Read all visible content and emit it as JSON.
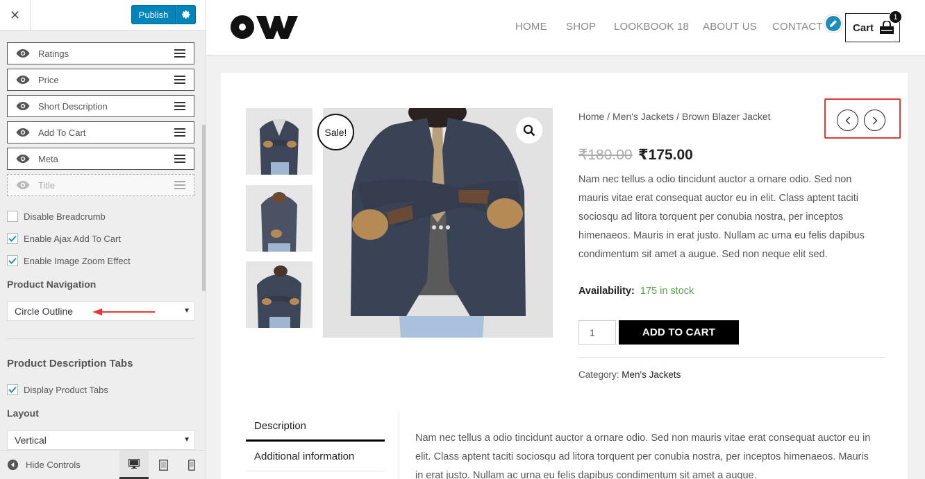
{
  "sidebar": {
    "publish_label": "Publish",
    "elements": [
      {
        "label": "Ratings",
        "visible": true
      },
      {
        "label": "Price",
        "visible": true
      },
      {
        "label": "Short Description",
        "visible": true
      },
      {
        "label": "Add To Cart",
        "visible": true
      },
      {
        "label": "Meta",
        "visible": true
      },
      {
        "label": "Title",
        "visible": false
      }
    ],
    "checkboxes": [
      {
        "label": "Disable Breadcrumb",
        "checked": false
      },
      {
        "label": "Enable Ajax Add To Cart",
        "checked": true
      },
      {
        "label": "Enable Image Zoom Effect",
        "checked": true
      }
    ],
    "product_navigation_heading": "Product Navigation",
    "product_navigation_value": "Circle Outline",
    "description_tabs_heading": "Product Description Tabs",
    "display_tabs_label": "Display Product Tabs",
    "display_tabs_checked": true,
    "layout_heading": "Layout",
    "layout_value": "Vertical",
    "hide_controls_label": "Hide Controls",
    "accent_color": "#0085ba"
  },
  "header": {
    "nav": [
      "HOME",
      "SHOP",
      "LOOKBOOK 18",
      "ABOUT US",
      "CONTACT US"
    ],
    "cart_label": "Cart",
    "cart_count": "1"
  },
  "product": {
    "sale_badge": "Sale!",
    "breadcrumb": "Home / Men's Jackets / Brown Blazer Jacket",
    "old_price": "₹180.00",
    "new_price": "₹175.00",
    "short_description": "Nam nec tellus a odio tincidunt auctor a ornare odio. Sed non mauris vitae erat consequat auctor eu in elit. Class aptent taciti sociosqu ad litora torquent per conubia nostra, per inceptos himenaeos. Mauris in erat justo. Nullam ac urna eu felis dapibus condimentum sit amet a augue. Sed non neque elit sed.",
    "availability_label": "Availability:",
    "availability_value": "175 in stock",
    "availability_color": "#5a9e4b",
    "quantity": "1",
    "add_to_cart_label": "ADD TO CART",
    "category_label": "Category:",
    "category_value": "Men's Jackets",
    "highlight_color": "#e53935"
  },
  "tabs": {
    "description_label": "Description",
    "additional_label": "Additional information",
    "content": "Nam nec tellus a odio tincidunt auctor a ornare odio. Sed non mauris vitae erat consequat auctor eu in elit. Class aptent taciti sociosqu ad litora torquent per conubia nostra, per inceptos himenaeos. Mauris in erat justo. Nullam ac urna eu felis dapibus condimentum sit amet a augue."
  }
}
